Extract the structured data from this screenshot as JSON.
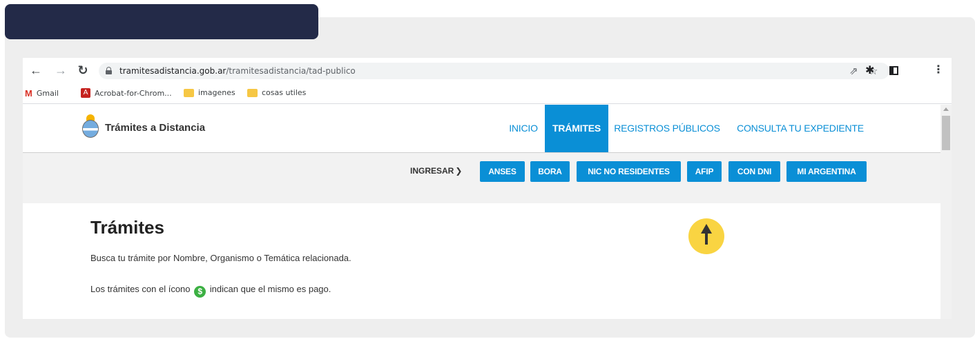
{
  "browser": {
    "url_host": "tramitesadistancia.gob.ar",
    "url_path": "/tramitesadistancia/tad-publico",
    "nav_icons": {
      "back": "back-arrow-icon",
      "forward": "forward-arrow-icon",
      "reload": "reload-icon"
    },
    "toolbar_icons": [
      "share-icon",
      "star-icon",
      "extensions-icon",
      "side-panel-icon",
      "menu-icon"
    ],
    "bookmarks": [
      {
        "label": "Gmail",
        "icon": "gmail-icon"
      },
      {
        "label": "Acrobat-for-Chrom...",
        "icon": "acrobat-icon"
      },
      {
        "label": "imagenes",
        "icon": "folder-icon"
      },
      {
        "label": "cosas utiles",
        "icon": "folder-icon"
      }
    ]
  },
  "site": {
    "title": "Trámites a Distancia",
    "nav": [
      {
        "label": "INICIO",
        "active": false
      },
      {
        "label": "TRÁMITES",
        "active": true
      },
      {
        "label": "REGISTROS PÚBLICOS",
        "active": false
      },
      {
        "label": "CONSULTA TU EXPEDIENTE",
        "active": false
      }
    ],
    "accent_color": "#0a8fd6"
  },
  "login": {
    "label": "INGRESAR",
    "buttons": [
      "ANSES",
      "BORA",
      "NIC NO RESIDENTES",
      "AFIP",
      "CON DNI",
      "MI ARGENTINA"
    ]
  },
  "content": {
    "title": "Trámites",
    "line1": "Busca tu trámite por Nombre, Organismo o Temática relacionada.",
    "line2_before": "Los trámites con el ícono",
    "line2_after": "indican que el mismo es pago."
  }
}
